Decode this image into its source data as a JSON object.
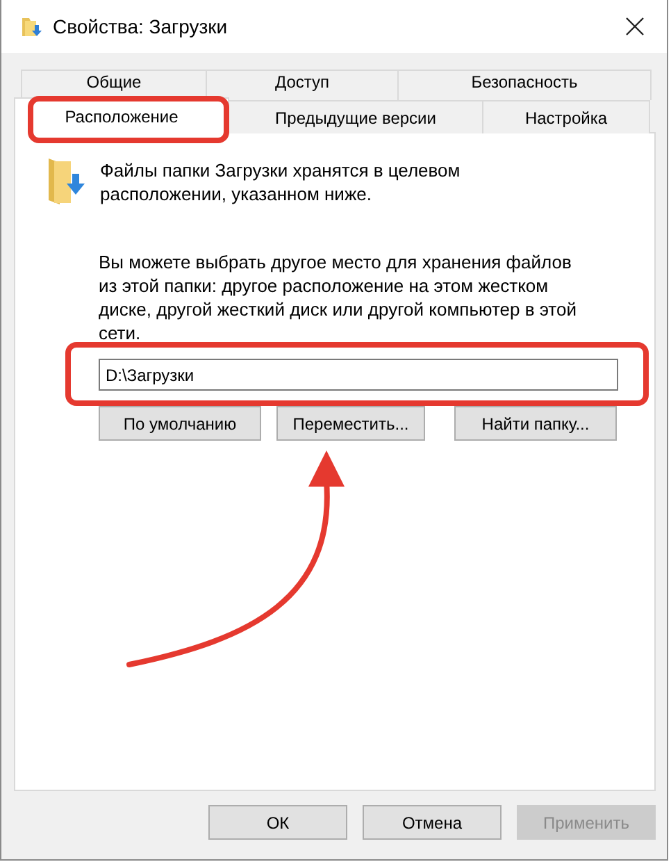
{
  "window": {
    "title": "Свойства: Загрузки"
  },
  "tab_rows": [
    [
      {
        "label": "Общие",
        "selected": false
      },
      {
        "label": "Доступ",
        "selected": false
      },
      {
        "label": "Безопасность",
        "selected": false
      }
    ],
    [
      {
        "label": "Расположение",
        "selected": true
      },
      {
        "label": "Предыдущие версии",
        "selected": false
      },
      {
        "label": "Настройка",
        "selected": false
      }
    ]
  ],
  "panel": {
    "info": "Файлы папки Загрузки хранятся в целевом расположении, указанном ниже.",
    "description": "Вы можете выбрать другое место для хранения файлов из этой папки: другое расположение на этом жестком диске, другой жесткий диск или другой компьютер в этой сети.",
    "path_field": {
      "value": "D:\\Загрузки"
    },
    "buttons": [
      {
        "label": "По умолчанию",
        "disabled": false
      },
      {
        "label": "Переместить...",
        "disabled": false
      },
      {
        "label": "Найти папку...",
        "disabled": false
      }
    ]
  },
  "dialog_buttons": [
    {
      "label": "ОК",
      "disabled": false
    },
    {
      "label": "Отмена",
      "disabled": false
    },
    {
      "label": "Применить",
      "disabled": true
    }
  ]
}
